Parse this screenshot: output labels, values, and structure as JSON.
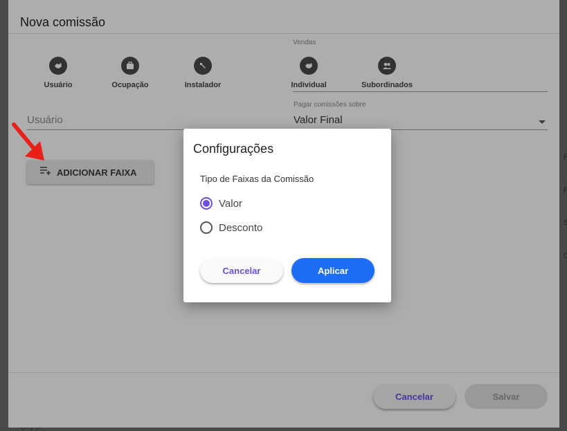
{
  "background": {
    "bottom_text": "(...) )ᴘ",
    "side_letters": [
      "F",
      "F",
      "S",
      "C"
    ]
  },
  "main_dialog": {
    "title": "Nova comissão",
    "roles": [
      {
        "label": "Usuário",
        "icon": "handshake-icon"
      },
      {
        "label": "Ocupação",
        "icon": "briefcase-icon"
      },
      {
        "label": "Instalador",
        "icon": "wrench-icon"
      }
    ],
    "vendas": {
      "label": "Vendas",
      "items": [
        {
          "label": "Individual",
          "icon": "handshake-icon"
        },
        {
          "label": "Subordinados",
          "icon": "people-icon"
        }
      ]
    },
    "usuario_field": {
      "placeholder": "Usuário"
    },
    "pagar_field": {
      "label": "Pagar comissões sobre",
      "value": "Valor Final"
    },
    "add_button": {
      "label": "ADICIONAR FAIXA",
      "icon": "playlist-add-icon"
    },
    "footer": {
      "cancel_label": "Cancelar",
      "save_label": "Salvar"
    }
  },
  "modal": {
    "title": "Configurações",
    "subtitle": "Tipo de Faixas da Comissão",
    "options": [
      {
        "label": "Valor",
        "checked": true
      },
      {
        "label": "Desconto",
        "checked": false
      }
    ],
    "cancel_label": "Cancelar",
    "apply_label": "Aplicar"
  },
  "colors": {
    "accent": "#6c4ee0",
    "primary_button": "#1e6ef5",
    "annotation_arrow": "#e8201a"
  }
}
